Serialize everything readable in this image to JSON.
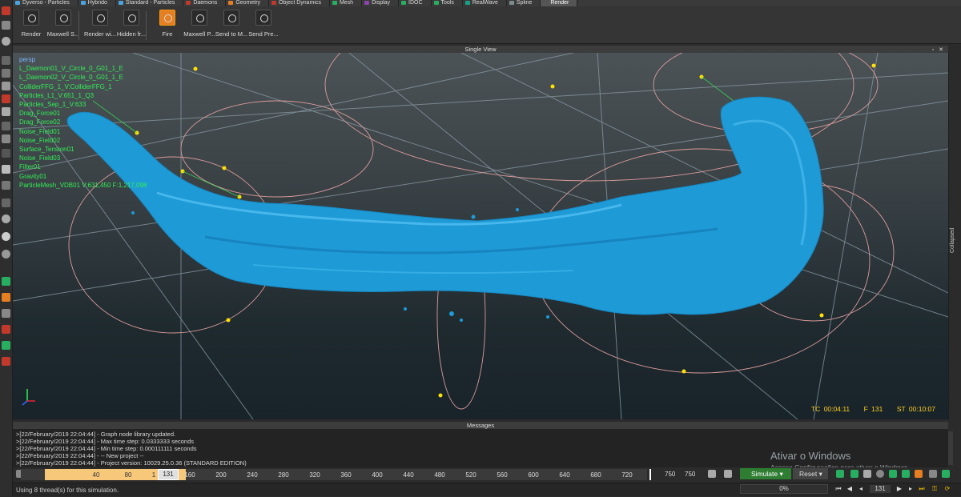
{
  "tabs": [
    {
      "label": "Dyverso - Particles",
      "color": "#4aa3df"
    },
    {
      "label": "Hybrido",
      "color": "#4aa3df"
    },
    {
      "label": "Standard - Particles",
      "color": "#4aa3df"
    },
    {
      "label": "Daemons",
      "color": "#c0392b"
    },
    {
      "label": "Geometry",
      "color": "#e67e22"
    },
    {
      "label": "Object Dynamics",
      "color": "#c0392b"
    },
    {
      "label": "Mesh",
      "color": "#27ae60"
    },
    {
      "label": "Display",
      "color": "#8e44ad"
    },
    {
      "label": "IDOC",
      "color": "#27ae60"
    },
    {
      "label": "Tools",
      "color": "#27ae60"
    },
    {
      "label": "RealWave",
      "color": "#16a085"
    },
    {
      "label": "Spline",
      "color": "#7f8c8d"
    },
    {
      "label": "Render",
      "color": "#555555",
      "active": true
    }
  ],
  "toolbar": {
    "buttons": [
      {
        "label": "Render",
        "icon": "render-icon"
      },
      {
        "label": "Maxwell S...",
        "icon": "maxwell-settings-icon"
      },
      {
        "label": "Render wi...",
        "icon": "render-window-icon"
      },
      {
        "label": "Hidden fr...",
        "icon": "hidden-frame-icon"
      },
      {
        "label": "Fire",
        "icon": "fire-icon"
      },
      {
        "label": "Maxwell P...",
        "icon": "maxwell-preview-icon"
      },
      {
        "label": "Send to M...",
        "icon": "send-to-maxwell-icon"
      },
      {
        "label": "Send Pre...",
        "icon": "send-preview-icon"
      }
    ]
  },
  "viewport": {
    "title": "Single View",
    "camera": "persp",
    "outliner": [
      "L_Daemon01_V_Circle_0_G01_1_E",
      "L_Daemon02_V_Circle_0_G01_1_E",
      "ColliderFFG_1_V:ColliderFFG_1",
      "Particles_L1_V:651_1_Q3",
      "Particles_Sep_1_V:633",
      "Drag_Force01",
      "Drag_Force02",
      "Noise_Field01",
      "Noise_Field02",
      "Surface_Tension01",
      "Noise_Field03",
      "Filter01",
      "Gravity01",
      "ParticleMesh_VDB01 V:631,450 F:1,217,098"
    ],
    "stats": {
      "tc": "TC 00:04:11",
      "frame": "F 131",
      "st": "ST 00:10:07"
    },
    "side_label": "Collapsed",
    "colors": {
      "mesh": "#1e9ad6",
      "grid": "#8a9aa4",
      "spline": "#d99a9a",
      "point": "#ffe000",
      "outliner_text": "#33ee55"
    }
  },
  "messages": {
    "title": "Messages",
    "lines": [
      ">[22/February/2019 22:04:44] - Graph node library updated.",
      ">[22/February/2019 22:04:44] - Max time step: 0.0333333 seconds",
      ">[22/February/2019 22:04:44] - Min time step: 0.000111111 seconds",
      ">[22/February/2019 22:04:44] - -- New project --",
      ">[22/February/2019 22:04:44] - Project version: 10029.25.0.36 (STANDARD EDITION)"
    ]
  },
  "windows_watermark": {
    "title": "Ativar o Windows",
    "subtitle": "Acesse Configurações para ativar o Windows."
  },
  "timeline": {
    "start": "0",
    "ticks": [
      "40",
      "80",
      "1",
      "160",
      "200",
      "240",
      "280",
      "320",
      "360",
      "400",
      "440",
      "480",
      "520",
      "560",
      "600",
      "640",
      "680",
      "720"
    ],
    "current_frame": "131",
    "end_a": "750",
    "end_b": "750",
    "simulate_label": "Simulate",
    "reset_label": "Reset"
  },
  "status": {
    "text": "Using 8 thread(s) for this simulation.",
    "progress": "0%",
    "frame": "131"
  }
}
